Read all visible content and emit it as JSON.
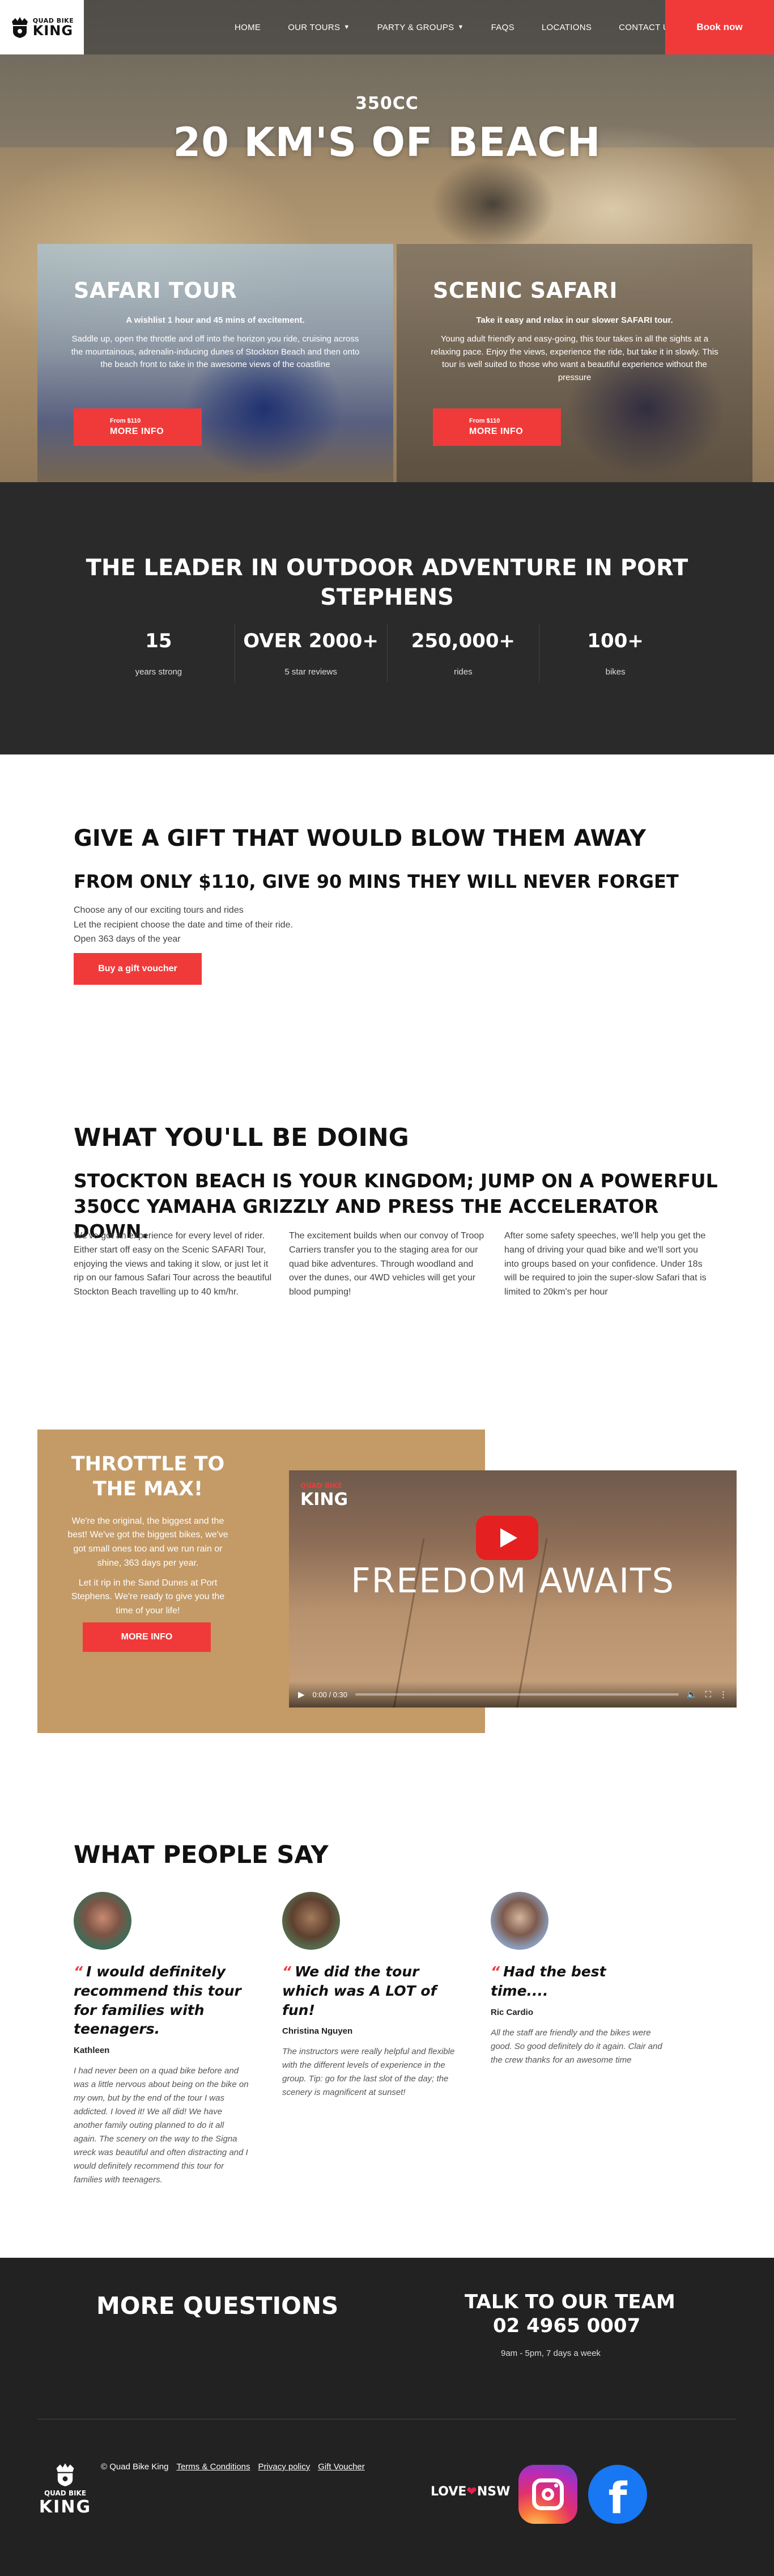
{
  "nav": {
    "logo_small": "QUAD BIKE",
    "logo_big": "KING",
    "links": [
      {
        "label": "HOME",
        "dropdown": false
      },
      {
        "label": "OUR TOURS",
        "dropdown": true
      },
      {
        "label": "PARTY & GROUPS",
        "dropdown": true
      },
      {
        "label": "FAQS",
        "dropdown": false
      },
      {
        "label": "LOCATIONS",
        "dropdown": false
      },
      {
        "label": "CONTACT US",
        "dropdown": false
      }
    ],
    "book_label": "Book now"
  },
  "hero": {
    "subtitle": "350CC",
    "title": "20 KM'S OF BEACH"
  },
  "tours": [
    {
      "title": "SAFARI TOUR",
      "lead": "A wishlist 1 hour and 45 mins of excitement.",
      "desc": "Saddle up, open the throttle and off into the horizon you ride, cruising across the mountainous, adrenalin-inducing dunes of Stockton Beach and then onto the beach front to take in the awesome views of the coastline",
      "price": "From $110",
      "button": "MORE INFO"
    },
    {
      "title": "SCENIC SAFARI",
      "lead": "Take it easy and relax in our slower SAFARI tour.",
      "desc": "Young adult friendly and easy-going, this tour takes in all the sights at a relaxing pace. Enjoy the views, experience the ride, but take it in slowly. This tour is well suited to those who want a beautiful experience without the pressure",
      "price": "From $110",
      "button": "MORE INFO"
    }
  ],
  "stats": {
    "title": "THE LEADER IN OUTDOOR ADVENTURE IN PORT STEPHENS",
    "items": [
      {
        "value": "15",
        "label": "years strong"
      },
      {
        "value": "OVER 2000+",
        "label": "5 star reviews"
      },
      {
        "value": "250,000+",
        "label": "rides"
      },
      {
        "value": "100+",
        "label": "bikes"
      }
    ]
  },
  "gift": {
    "title": "GIVE A GIFT THAT WOULD BLOW THEM AWAY",
    "subtitle": "FROM ONLY $110, GIVE 90 MINS THEY WILL NEVER FORGET",
    "lines": [
      "Choose any of our exciting tours and rides",
      "Let the recipient choose the date and time of their ride.",
      "Open 363 days of the year"
    ],
    "button": "Buy a gift voucher"
  },
  "doing": {
    "title": "WHAT YOU'LL BE DOING",
    "subtitle": "STOCKTON BEACH IS YOUR KINGDOM; JUMP ON A POWERFUL 350CC YAMAHA GRIZZLY AND PRESS THE ACCELERATOR DOWN.",
    "columns": [
      "We've got an experience for every level of rider. Either start off easy on the Scenic SAFARI Tour, enjoying the views and taking it slow, or just let it rip on our famous Safari Tour across the beautiful Stockton Beach travelling up to 40 km/hr.",
      "The excitement builds when our convoy of Troop Carriers transfer you to the staging area for our quad bike adventures. Through woodland and over the dunes, our 4WD vehicles will get your blood pumping!",
      "After some safety speeches, we'll help you get the hang of driving your quad bike and we'll sort you into groups based on your confidence. Under 18s will be required to join the super-slow Safari that is limited to 20km's per hour"
    ]
  },
  "throttle": {
    "title": "THROTTLE TO THE MAX!",
    "text1": "We're the original, the biggest and the best! We've got the biggest bikes, we've got small ones too and we run rain or shine, 363 days per year.",
    "text2": "Let it rip in the Sand Dunes at Port Stephens. We're ready to give you the time of your life!",
    "button": "MORE INFO",
    "video": {
      "logo_small": "QUAD BIKE",
      "logo_big": "KING",
      "caption": "FREEDOM AWAITS",
      "time": "0:00 / 0:30"
    }
  },
  "reviews": {
    "title": "WHAT PEOPLE SAY",
    "items": [
      {
        "quote": "I would definitely recommend this tour for families with teenagers.",
        "name": "Kathleen",
        "text": "I had never been on a quad bike before and was a little nervous about being on the bike on my own, but by the end of the tour I was addicted. I loved it! We all did! We have another family outing planned to do it all again. The scenery on the way to the Signa wreck was beautiful and often distracting and I would definitely recommend this tour for families with teenagers."
      },
      {
        "quote": "We did the tour which was A LOT of fun!",
        "name": "Christina Nguyen",
        "text": "The instructors were really helpful and flexible with the different levels of experience in the group. Tip: go for the last slot of the day; the scenery is magnificent at sunset!"
      },
      {
        "quote": "Had the best time....",
        "name": "Ric Cardio",
        "text": "All the staff are friendly and the bikes were good. So good definitely do it again. Clair and the crew thanks for an awesome time"
      }
    ]
  },
  "footer": {
    "questions_title": "MORE QUESTIONS",
    "talk_title": "TALK TO OUR TEAM",
    "phone": "02 4965 0007",
    "hours": "9am - 5pm, 7 days a week",
    "copyright": "© Quad Bike King",
    "links": [
      "Terms & Conditions",
      "Privacy policy",
      "Gift Voucher"
    ],
    "love": "LOVE",
    "nsw": "NSW",
    "logo_small": "QUAD BIKE",
    "logo_big": "KING"
  }
}
